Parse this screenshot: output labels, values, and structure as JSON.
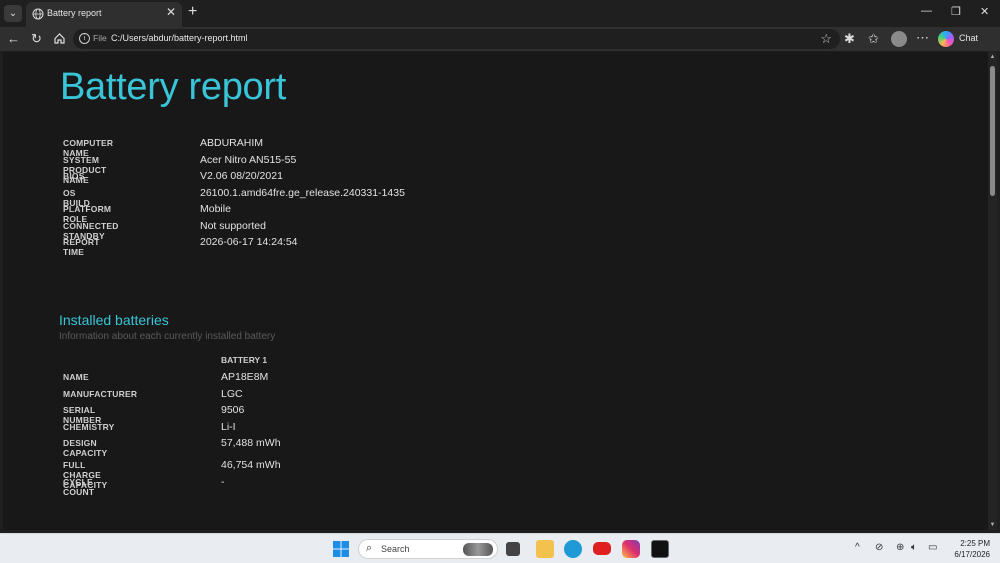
{
  "browser": {
    "tab_title": "Battery report",
    "address_prefix": "File",
    "url": "C:/Users/abdur/battery-report.html",
    "chat_label": "Chat"
  },
  "report": {
    "title": "Battery report",
    "system_info": [
      {
        "label": "COMPUTER NAME",
        "value": "ABDURAHIM"
      },
      {
        "label": "SYSTEM PRODUCT NAME",
        "value": "Acer Nitro AN515-55"
      },
      {
        "label": "BIOS",
        "value": "V2.06 08/20/2021"
      },
      {
        "label": "OS BUILD",
        "value": "26100.1.amd64fre.ge_release.240331-1435"
      },
      {
        "label": "PLATFORM ROLE",
        "value": "Mobile"
      },
      {
        "label": "CONNECTED STANDBY",
        "value": "Not supported"
      },
      {
        "label": "REPORT TIME",
        "value": "2026-06-17  14:24:54"
      }
    ],
    "installed_batteries": {
      "title": "Installed batteries",
      "subtitle": "Information about each currently installed battery",
      "column_header": "BATTERY 1",
      "rows": [
        {
          "label": "NAME",
          "value": "AP18E8M"
        },
        {
          "label": "MANUFACTURER",
          "value": "LGC"
        },
        {
          "label": "SERIAL NUMBER",
          "value": "9506"
        },
        {
          "label": "CHEMISTRY",
          "value": "Li-I"
        },
        {
          "label": "DESIGN CAPACITY",
          "value": "57,488 mWh"
        },
        {
          "label": "FULL CHARGE CAPACITY",
          "value": "46,754 mWh"
        },
        {
          "label": "CYCLE COUNT",
          "value": "-"
        }
      ]
    }
  },
  "taskbar": {
    "search_placeholder": "Search",
    "time": "2:25 PM",
    "date": "6/17/2026"
  },
  "colors": {
    "accent": "#39c4d8",
    "page_background": "#181818",
    "browser_chrome": "#2f2f2f"
  }
}
